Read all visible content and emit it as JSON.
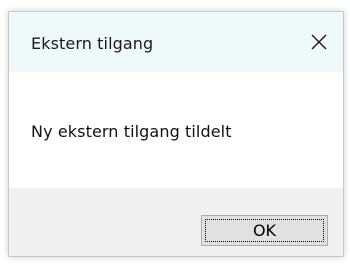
{
  "window": {
    "title": "Ekstern tilgang",
    "close_icon": "close-icon",
    "titlebar_color": "#eefaf9"
  },
  "message": {
    "text": "Ny ekstern tilgang tildelt"
  },
  "buttons": {
    "ok_label": "OK"
  }
}
